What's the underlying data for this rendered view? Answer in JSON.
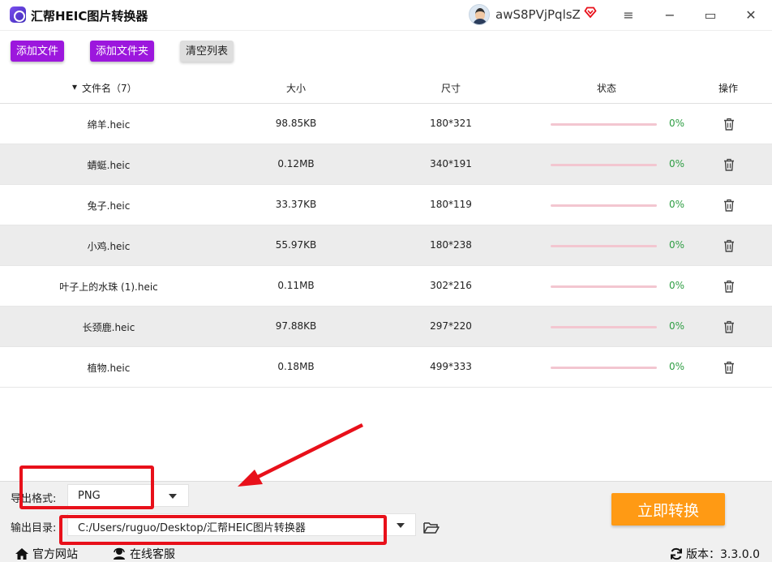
{
  "app": {
    "title": "汇帮HEIC图片转换器",
    "username": "awS8PVjPqlsZ"
  },
  "window": {
    "menu_icon": "≡",
    "min_icon": "−",
    "max_icon": "▭",
    "close_icon": "✕"
  },
  "toolbar": {
    "add_files": "添加文件",
    "add_folder": "添加文件夹",
    "clear_list": "清空列表"
  },
  "table": {
    "headers": {
      "name": "文件名（7）",
      "size": "大小",
      "dimensions": "尺寸",
      "status": "状态",
      "actions": "操作"
    },
    "rows": [
      {
        "name": "绵羊.heic",
        "size": "98.85KB",
        "dims": "180*321",
        "progress": "0%"
      },
      {
        "name": "蜻蜓.heic",
        "size": "0.12MB",
        "dims": "340*191",
        "progress": "0%"
      },
      {
        "name": "兔子.heic",
        "size": "33.37KB",
        "dims": "180*119",
        "progress": "0%"
      },
      {
        "name": "小鸡.heic",
        "size": "55.97KB",
        "dims": "180*238",
        "progress": "0%"
      },
      {
        "name": "叶子上的水珠 (1).heic",
        "size": "0.11MB",
        "dims": "302*216",
        "progress": "0%"
      },
      {
        "name": "长颈鹿.heic",
        "size": "97.88KB",
        "dims": "297*220",
        "progress": "0%"
      },
      {
        "name": "植物.heic",
        "size": "0.18MB",
        "dims": "499*333",
        "progress": "0%"
      }
    ]
  },
  "output": {
    "format_label": "导出格式:",
    "format_value": "PNG",
    "dir_label": "输出目录:",
    "dir_value": "C:/Users/ruguo/Desktop/汇帮HEIC图片转换器"
  },
  "convert_button": "立即转换",
  "footer": {
    "website": "官方网站",
    "support": "在线客服",
    "version": "版本：3.3.0.0"
  },
  "colors": {
    "accent_purple": "#9c17dd",
    "convert_orange": "#ff9a14",
    "progress_green": "#2f9e44",
    "annotation_red": "#e8101a"
  }
}
